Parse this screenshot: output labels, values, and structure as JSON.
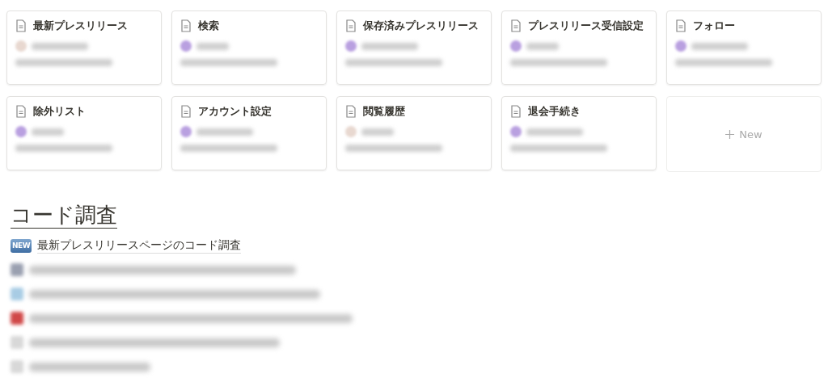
{
  "cards": [
    {
      "title": "最新プレスリリース",
      "color": "#e8d8d0"
    },
    {
      "title": "検索",
      "color": "#b9a0e0"
    },
    {
      "title": "保存済みプレスリリース",
      "color": "#b9a0e0"
    },
    {
      "title": "プレスリリース受信設定",
      "color": "#b9a0e0"
    },
    {
      "title": "フォロー",
      "color": "#b9a0e0"
    },
    {
      "title": "除外リスト",
      "color": "#b9a0e0"
    },
    {
      "title": "アカウント設定",
      "color": "#b9a0e0"
    },
    {
      "title": "閲覧履歴",
      "color": "#e8d8d0"
    },
    {
      "title": "退会手続き",
      "color": "#b9a0e0"
    }
  ],
  "new_card": {
    "label": "New"
  },
  "section": {
    "heading": "コード調査",
    "items": [
      {
        "kind": "text",
        "icon_label": "NEW",
        "title": "最新プレスリリースページのコード調査"
      },
      {
        "kind": "redacted",
        "color": "#9aa0b0"
      },
      {
        "kind": "redacted",
        "color": "#a8cce4"
      },
      {
        "kind": "redacted",
        "color": "#d04848"
      },
      {
        "kind": "redacted",
        "color": "#d8d8d8"
      },
      {
        "kind": "redacted",
        "color": "#d8d8d8"
      }
    ]
  }
}
